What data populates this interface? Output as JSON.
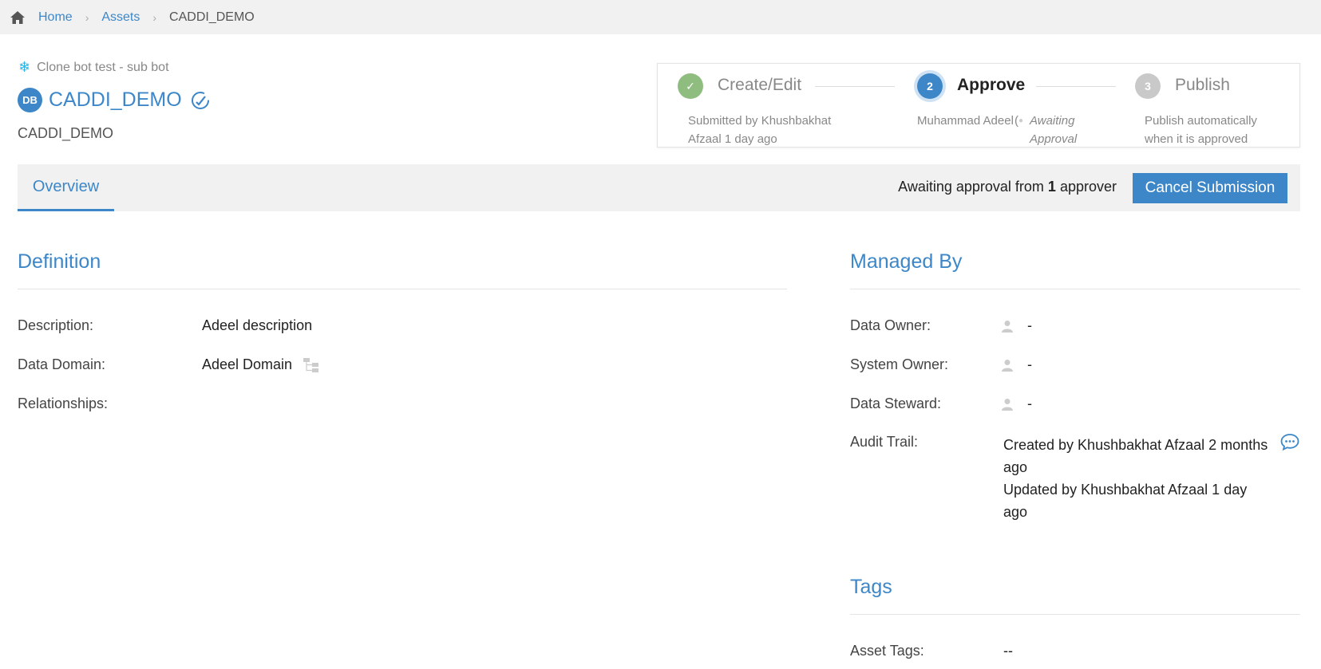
{
  "breadcrumb": {
    "items": [
      "Home",
      "Assets"
    ],
    "current": "CADDI_DEMO"
  },
  "header": {
    "source": "Clone bot test - sub bot",
    "badge": "DB",
    "title": "CADDI_DEMO",
    "subtitle": "CADDI_DEMO"
  },
  "stepper": {
    "steps": [
      {
        "number": "✓",
        "label": "Create/Edit",
        "desc": "Submitted by Khushbakhat Afzaal 1 day ago",
        "state": "done"
      },
      {
        "number": "2",
        "label": "Approve",
        "desc_name": "Muhammad Adeel",
        "desc_status": "Awaiting Approval",
        "state": "active"
      },
      {
        "number": "3",
        "label": "Publish",
        "desc": "Publish automatically when it is approved",
        "state": "pending"
      }
    ]
  },
  "tabs": {
    "overview": "Overview"
  },
  "approval": {
    "prefix": "Awaiting approval from",
    "count": "1",
    "suffix": "approver",
    "cancel_label": "Cancel Submission"
  },
  "definition": {
    "title": "Definition",
    "description_label": "Description:",
    "description_value": "Adeel description",
    "domain_label": "Data Domain:",
    "domain_value": "Adeel Domain",
    "relationships_label": "Relationships:"
  },
  "managed_by": {
    "title": "Managed By",
    "data_owner_label": "Data Owner:",
    "data_owner_value": "-",
    "system_owner_label": "System Owner:",
    "system_owner_value": "-",
    "data_steward_label": "Data Steward:",
    "data_steward_value": "-",
    "audit_label": "Audit Trail:",
    "audit_created": "Created by Khushbakhat Afzaal 2 months ago",
    "audit_updated": "Updated by Khushbakhat Afzaal 1 day ago"
  },
  "tags": {
    "title": "Tags",
    "asset_tags_label": "Asset Tags:",
    "asset_tags_value": "--"
  },
  "colors": {
    "accent": "#3d87c8",
    "done": "#8fbc7f",
    "pending": "#c9c9c9",
    "snowflake": "#29b5e8"
  }
}
